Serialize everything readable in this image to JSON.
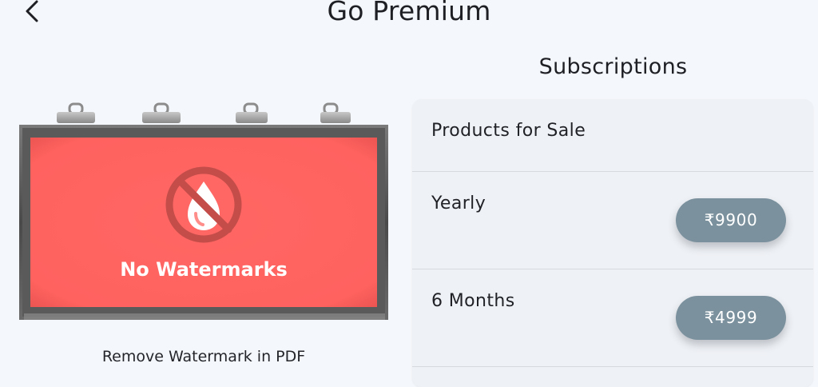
{
  "header": {
    "title": "Go Premium"
  },
  "promo": {
    "image_text": "No Watermarks",
    "caption": "Remove Watermark in PDF"
  },
  "subscriptions": {
    "heading": "Subscriptions",
    "section_label": "Products for Sale",
    "plans": [
      {
        "name": "Yearly",
        "price": "₹9900"
      },
      {
        "name": "6 Months",
        "price": "₹4999"
      }
    ]
  },
  "colors": {
    "background": "#f4f7fb",
    "panel": "#eef1f5",
    "price_button": "#7b919d",
    "billboard_fill": "#ff6461"
  },
  "icons": {
    "back": "chevron-left-icon",
    "no_watermark": "no-drop-icon"
  }
}
